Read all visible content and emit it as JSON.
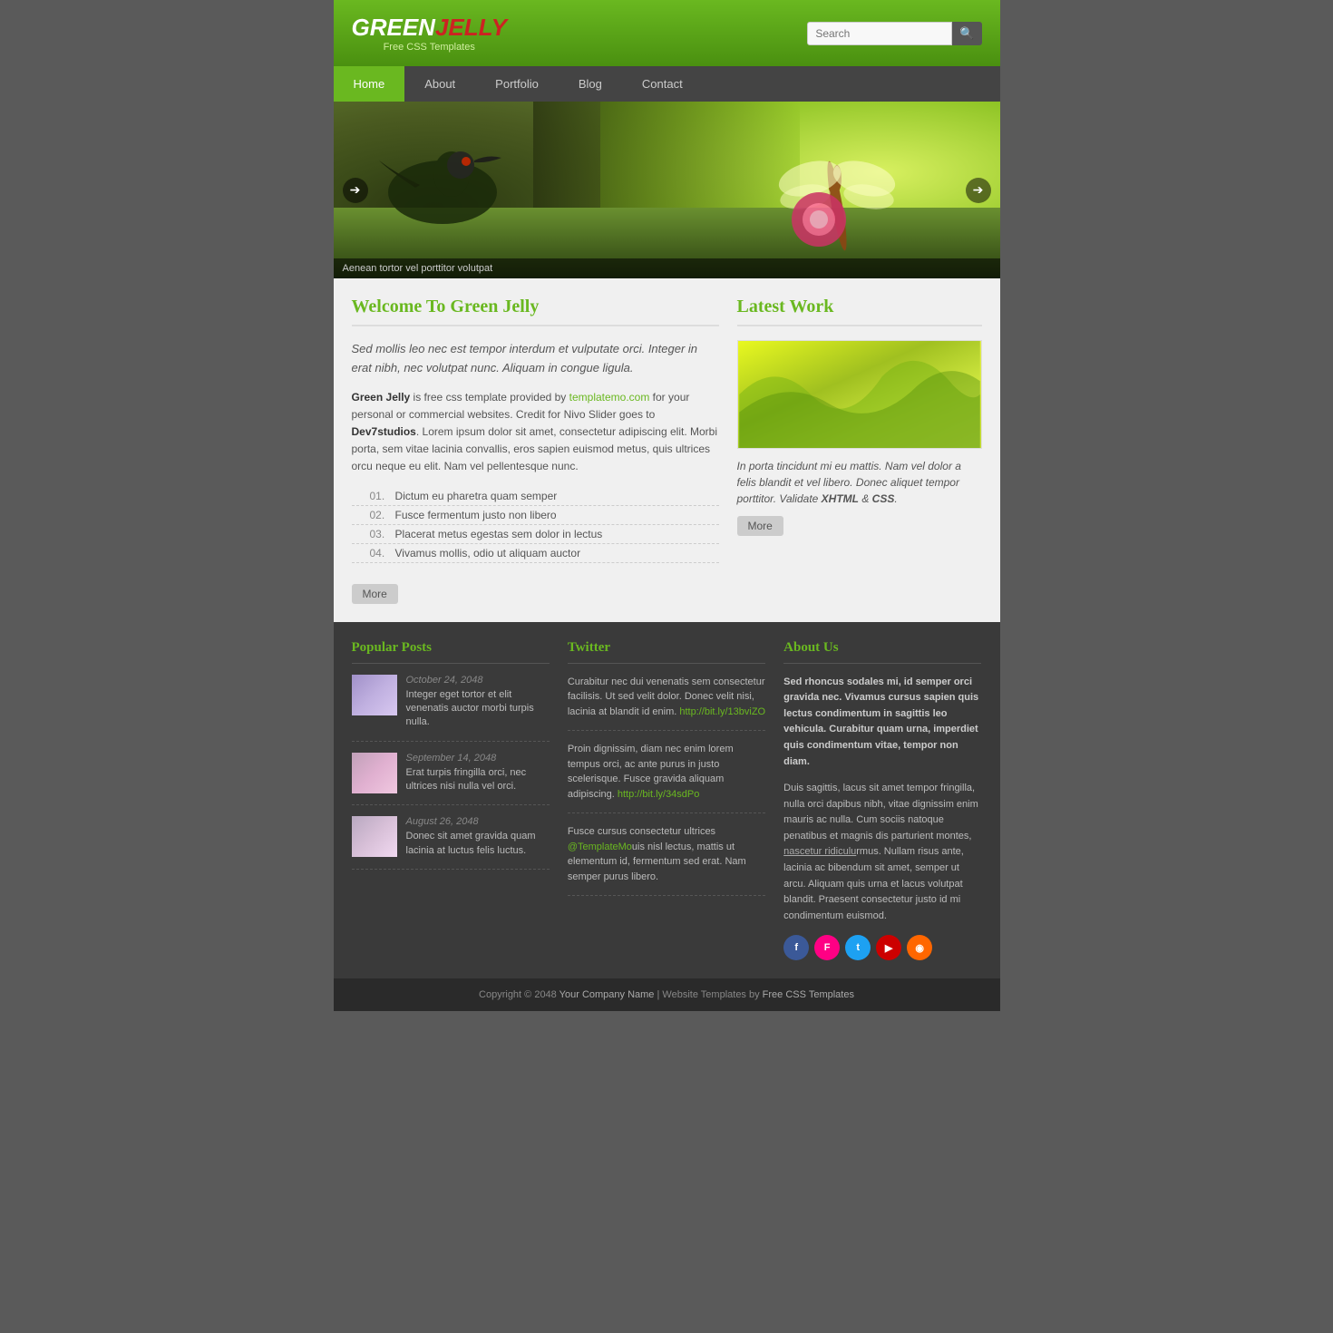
{
  "header": {
    "logo_green": "GREEN",
    "logo_jelly": "JELLY",
    "logo_tagline": "Free CSS Templates",
    "search_placeholder": "Search",
    "search_btn_icon": "🔍"
  },
  "nav": {
    "items": [
      {
        "label": "Home",
        "active": true
      },
      {
        "label": "About",
        "active": false
      },
      {
        "label": "Portfolio",
        "active": false
      },
      {
        "label": "Blog",
        "active": false
      },
      {
        "label": "Contact",
        "active": false
      }
    ]
  },
  "slider": {
    "caption": "Aenean tortor vel porttitor volutpat",
    "prev_icon": "➔",
    "next_icon": "➔"
  },
  "welcome": {
    "title": "Welcome To Green Jelly",
    "intro": "Sed mollis leo nec est tempor interdum et vulputate orci. Integer in erat nibh, nec volutpat nunc. Aliquam in congue ligula.",
    "body1": " is free css template provided by ",
    "body1_name": "Green Jelly",
    "body1_link": "templatemo.com",
    "body1_rest": " for your personal or commercial websites. Credit for Nivo Slider goes to ",
    "body1_link2": "Dev7studios",
    "body1_end": ". Lorem ipsum dolor sit amet, consectetur adipiscing elit. Morbi porta, sem vitae lacinia convallis, eros sapien euismod metus, quis ultrices orcu neque eu elit. Nam vel pellentesque nunc.",
    "list": [
      {
        "num": "01.",
        "text": "Dictum eu pharetra quam semper"
      },
      {
        "num": "02.",
        "text": "Fusce fermentum justo non libero"
      },
      {
        "num": "03.",
        "text": "Placerat metus egestas sem dolor in lectus"
      },
      {
        "num": "04.",
        "text": "Vivamus mollis, odio ut aliquam auctor"
      }
    ],
    "more_label": "More"
  },
  "latest_work": {
    "title": "Latest Work",
    "caption": "In porta tincidunt mi eu mattis. Nam vel dolor a felis blandit et vel libero. Donec aliquet tempor porttitor. Validate ",
    "xhtml": "XHTML",
    "amp": " & ",
    "css": "CSS",
    "more_label": "More"
  },
  "popular_posts": {
    "title": "Popular Posts",
    "posts": [
      {
        "date": "October 24, 2048",
        "text": "Integer eget tortor et elit venenatis auctor morbi turpis nulla."
      },
      {
        "date": "September 14, 2048",
        "text": "Erat turpis fringilla orci, nec ultrices nisi nulla vel orci."
      },
      {
        "date": "August 26, 2048",
        "text": "Donec sit amet gravida quam lacinia at luctus felis luctus."
      }
    ]
  },
  "twitter": {
    "title": "Twitter",
    "tweets": [
      {
        "text": "Curabitur nec dui venenatis sem consectetur facilisis. Ut sed velit dolor. Donec velit nisi, lacinia at blandit id enim. ",
        "link": "http://bit.ly/13bviZO"
      },
      {
        "text": "Proin dignissim, diam nec enim lorem tempus orci, ac ante purus in justo scelerisque. Fusce gravida aliquam adipiscing. ",
        "link": "http://bit.ly/34sdPo"
      },
      {
        "text": "Fusce cursus consectetur ultrices ",
        "handle": "@TemplateMo",
        "text2": "uis nisl lectus, mattis ut elementum id, fermentum sed erat. Nam semper purus libero."
      }
    ]
  },
  "about_us": {
    "title": "About Us",
    "para1": "Sed rhoncus sodales mi, id semper orci gravida nec. Vivamus cursus sapien quis lectus condimentum in sagittis leo vehicula. Curabitur quam urna, imperdiet quis condimentum vitae, tempor non diam.",
    "para2": "Duis sagittis, lacus sit amet tempor fringilla, nulla orci dapibus nibh, vitae dignissim enim mauris ac nulla. Cum sociis natoque penatibus et magnis dis parturient montes, ",
    "para2_link": "nascetur ridiculu",
    "para2_end": "rmus. Nullam risus ante, lacinia ac bibendum sit amet, semper ut arcu. Aliquam quis urna et lacus volutpat blandit. Praesent consectetur justo id mi condimentum euismod.",
    "social": [
      {
        "name": "facebook",
        "class": "si-fb",
        "label": "f"
      },
      {
        "name": "flickr",
        "class": "si-fl",
        "label": "F"
      },
      {
        "name": "twitter",
        "class": "si-tw",
        "label": "t"
      },
      {
        "name": "youtube",
        "class": "si-yt",
        "label": "▶"
      },
      {
        "name": "rss",
        "class": "si-rss",
        "label": "◉"
      }
    ]
  },
  "footer": {
    "copyright": "Copyright © 2048 ",
    "company": "Your Company Name",
    "separator": " | ",
    "templates_text": "Website Templates by ",
    "templates_link": "Free CSS Templates"
  }
}
